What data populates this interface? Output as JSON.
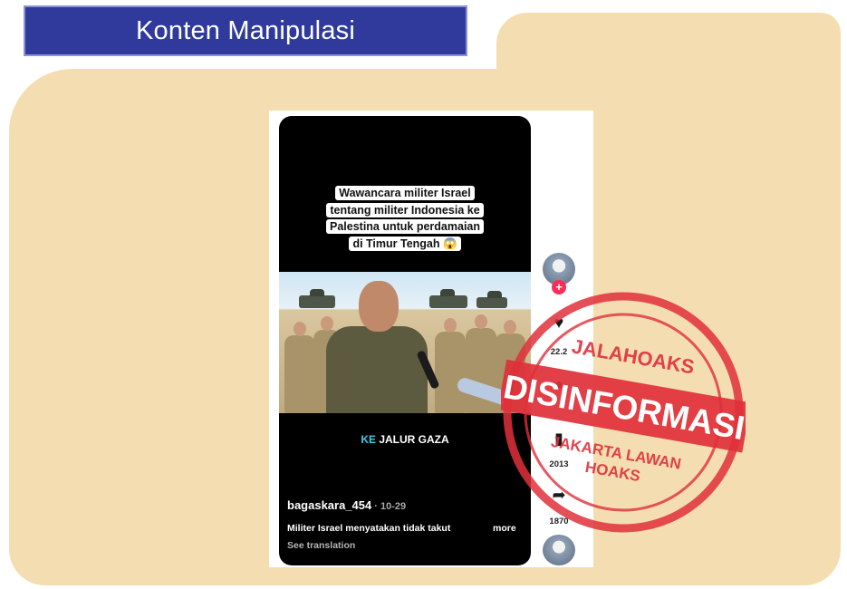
{
  "header": {
    "title": "Konten Manipulasi"
  },
  "post": {
    "caption": "Wawancara militer Israel tentang militer Indonesia ke Palestina untuk perdamaian di Timur Tengah 😱",
    "subtitle_highlight": "KE",
    "subtitle_rest": " JALUR GAZA",
    "username": "bagaskara_454",
    "date": " · 10-29",
    "description": "Militer Israel menyatakan tidak takut",
    "more_label": "more",
    "see_translation": "See translation"
  },
  "rail": {
    "follow_label": "+",
    "likes": "22.2",
    "saves": "2013",
    "shares": "1870"
  },
  "stamp": {
    "top_text": "JALAHOAKS",
    "main_text": "DISINFORMASI",
    "bottom_line1": "JAKARTA LAWAN",
    "bottom_line2": "HOAKS",
    "color": "#e0303a"
  },
  "colors": {
    "folder": "#f4ddb0",
    "banner": "#2f3a9c",
    "tiktok_red": "#fe2c55",
    "subtitle_accent": "#44c8ea"
  },
  "icons": [
    "heart-icon",
    "bookmark-icon",
    "share-icon",
    "comment-icon"
  ]
}
